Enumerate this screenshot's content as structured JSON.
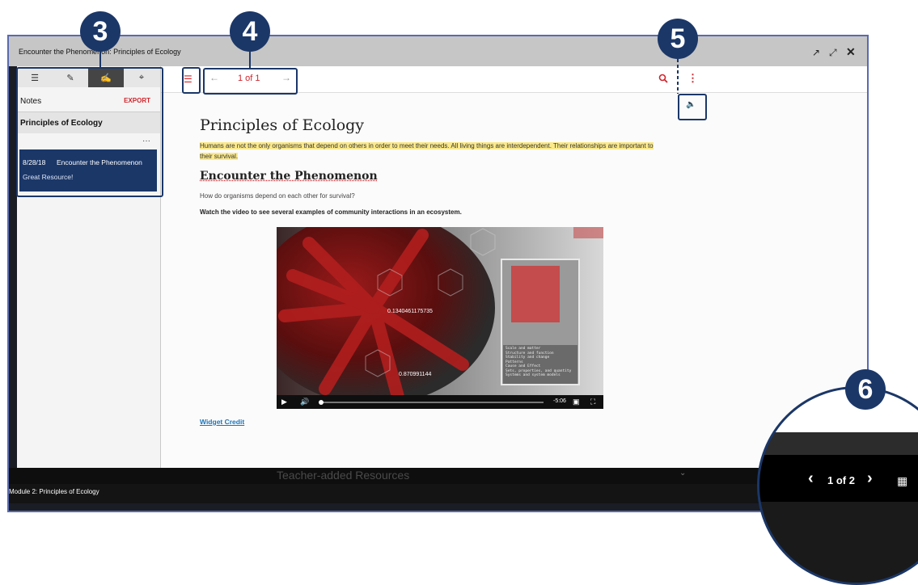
{
  "window": {
    "title": "Encounter the Phenomenon: Principles of Ecology"
  },
  "callouts": [
    "3",
    "4",
    "5",
    "6"
  ],
  "sidebar": {
    "tabs": [
      {
        "icon": "list-icon"
      },
      {
        "icon": "pencil-icon"
      },
      {
        "icon": "note-icon"
      },
      {
        "icon": "pin-icon"
      }
    ],
    "notes_label": "Notes",
    "export_label": "EXPORT",
    "section_title": "Principles of Ecology",
    "more_label": "···",
    "note": {
      "date": "8/28/18",
      "title": "Encounter the Phenomenon",
      "body": "Great Resource!"
    }
  },
  "toolbar": {
    "page_indicator": "1 of 1",
    "prev_glyph": "←",
    "next_glyph": "→"
  },
  "content": {
    "heading": "Principles of Ecology",
    "highlighted_text": "Humans are not the only organisms that depend on others in order to meet their needs. All living things are interdependent. Their relationships are important to their survival.",
    "subheading": "Encounter the Phenomenon",
    "question": "How do organisms depend on each other for survival?",
    "instruction": "Watch the video to see several examples of community interactions in an ecosystem.",
    "video": {
      "value_1": "0.1340461175735",
      "value_2": "0.870991144",
      "time": "-5:06",
      "panel_lines": [
        "Scale and matter",
        "Structure and function",
        "Stability and change",
        "Patterns",
        "Cause and Effect",
        "Sets, properties, and quantity",
        "Systems and system models"
      ]
    },
    "credit_link": "Widget Credit"
  },
  "footer": {
    "teacher_resources": "Teacher-added Resources",
    "module_label": "Module 2: Principles of Ecology"
  },
  "zoom": {
    "page_indicator": "1 of 2"
  },
  "colors": {
    "accent_red": "#d0242b",
    "callout_navy": "#1b3768",
    "highlight_yellow": "#fbe98a"
  }
}
